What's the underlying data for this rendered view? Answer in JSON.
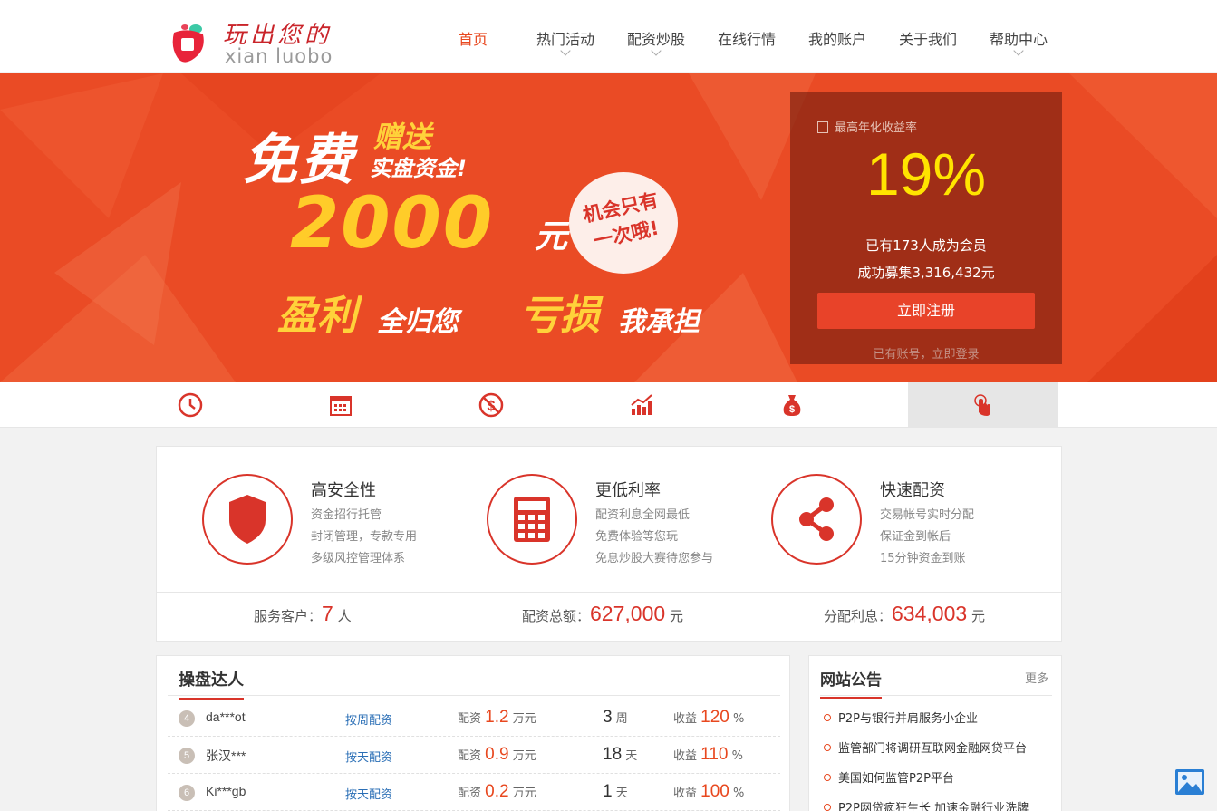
{
  "header": {
    "logo_cn": "玩出您的",
    "logo_en": "xian luobo",
    "nav": [
      {
        "label": "首页",
        "active": true,
        "dropdown": false
      },
      {
        "label": "热门活动",
        "active": false,
        "dropdown": true
      },
      {
        "label": "配资炒股",
        "active": false,
        "dropdown": true
      },
      {
        "label": "在线行情",
        "active": false,
        "dropdown": false
      },
      {
        "label": "我的账户",
        "active": false,
        "dropdown": false
      },
      {
        "label": "关于我们",
        "active": false,
        "dropdown": false
      },
      {
        "label": "帮助中心",
        "active": false,
        "dropdown": true
      }
    ]
  },
  "banner": {
    "free": "免费",
    "gift": "赠送",
    "fund": "实盘资金!",
    "amount": "2000",
    "unit": "元",
    "badge_line1": "机会只有",
    "badge_line2": "一次哦!",
    "profit_a": "盈利",
    "profit_b": "全归您",
    "loss_a": "亏损",
    "loss_b": "我承担"
  },
  "rate_panel": {
    "label": "最高年化收益率",
    "value": "19%",
    "members": "已有173人成为会员",
    "raised": "成功募集3,316,432元",
    "register": "立即注册",
    "login": "已有账号，立即登录"
  },
  "icon_strip": [
    {
      "icon": "clock-icon",
      "active": false
    },
    {
      "icon": "calendar-icon",
      "active": false
    },
    {
      "icon": "no-dollar-icon",
      "active": false
    },
    {
      "icon": "trend-chart-icon",
      "active": false
    },
    {
      "icon": "money-bag-icon",
      "active": false
    },
    {
      "icon": "touch-icon",
      "active": true
    }
  ],
  "features": [
    {
      "icon": "shield-icon",
      "title": "高安全性",
      "lines": [
        "资金招行托管",
        "封闭管理，专款专用",
        "多级风控管理体系"
      ]
    },
    {
      "icon": "calculator-icon",
      "title": "更低利率",
      "lines": [
        "配资利息全网最低",
        "免费体验等您玩",
        "免息炒股大赛待您参与"
      ]
    },
    {
      "icon": "share-icon",
      "title": "快速配资",
      "lines": [
        "交易帐号实时分配",
        "保证金到帐后",
        "15分钟资金到账"
      ]
    }
  ],
  "stats": [
    {
      "label": "服务客户：",
      "value": "7",
      "unit": "人"
    },
    {
      "label": "配资总额：",
      "value": "627,000",
      "unit": "元"
    },
    {
      "label": "分配利息：",
      "value": "634,003",
      "unit": "元"
    }
  ],
  "traders": {
    "title": "操盘达人",
    "rows": [
      {
        "rank": "4",
        "name": "da***ot",
        "mode": "按周配资",
        "fund_label": "配资",
        "fund": "1.2",
        "fund_unit": "万元",
        "period": "3",
        "period_unit": "周",
        "gain_label": "收益",
        "gain": "120",
        "gain_unit": "%"
      },
      {
        "rank": "5",
        "name": "张汉***",
        "mode": "按天配资",
        "fund_label": "配资",
        "fund": "0.9",
        "fund_unit": "万元",
        "period": "18",
        "period_unit": "天",
        "gain_label": "收益",
        "gain": "110",
        "gain_unit": "%"
      },
      {
        "rank": "6",
        "name": "Ki***gb",
        "mode": "按天配资",
        "fund_label": "配资",
        "fund": "0.2",
        "fund_unit": "万元",
        "period": "1",
        "period_unit": "天",
        "gain_label": "收益",
        "gain": "100",
        "gain_unit": "%"
      }
    ]
  },
  "notices": {
    "title": "网站公告",
    "more": "更多",
    "items": [
      "P2P与银行并肩服务小企业",
      "监管部门将调研互联网金融网贷平台",
      "美国如何监管P2P平台",
      "P2P网贷疯狂生长 加速金融行业洗牌"
    ]
  },
  "colors": {
    "brand": "#e8481f",
    "accent_red": "#d9342a",
    "banner": "#ea4b25",
    "rate": "#ffe400"
  }
}
